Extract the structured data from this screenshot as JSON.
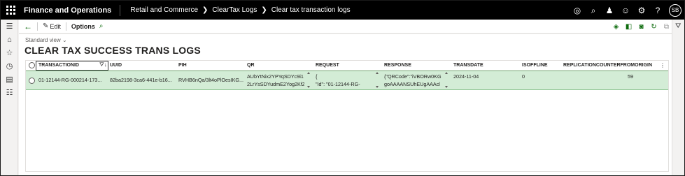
{
  "topbar": {
    "app_title": "Finance and Operations",
    "breadcrumbs": [
      "Retail and Commerce",
      "ClearTax Logs",
      "Clear tax transaction logs"
    ],
    "avatar_initials": "SB"
  },
  "actionpane": {
    "edit_label": "Edit",
    "options_label": "Options"
  },
  "page": {
    "view_label": "Standard view",
    "title": "CLEAR TAX SUCCESS TRANS LOGS"
  },
  "grid": {
    "columns": [
      "TRANSACTIONID",
      "UUID",
      "PIH",
      "QR",
      "REQUEST",
      "RESPONSE",
      "TRANSDATE",
      "ISOFFLINE",
      "REPLICATIONCOUNTERFROMORIGIN"
    ],
    "row": {
      "transactionid": "01-12144-RG-000214-173...",
      "uuid": "82ba2198-3ca6-441e-b16...",
      "pih": "RVHB6nQa/3lt4oPlOesIKG...",
      "qr_line1": "AUbYtNix2YPYqSDYc9i1",
      "qr_line2": "2LrYsSDYudmE2Yog2KfZ",
      "request_line1": "{",
      "request_line2": "\"Id\": \"01-12144-RG-",
      "response_line1": "{\"QRCode\":\"iVBORw0KG",
      "response_line2": "goAAAANSUhEUgAAAcl",
      "transdate": "2024-11-04",
      "isoffline": "0",
      "replicationcounter": "59"
    }
  },
  "colors": {
    "topbar": "#000000",
    "row_selected": "#d3ecd6",
    "accent_green": "#0b6a0b"
  }
}
